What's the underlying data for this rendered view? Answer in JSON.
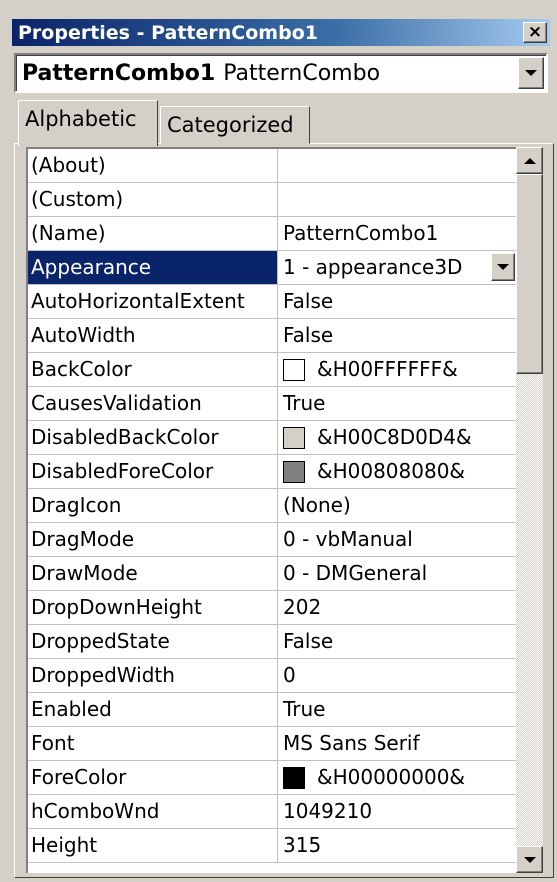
{
  "window": {
    "title": "Properties - PatternCombo1",
    "close_glyph": "×"
  },
  "object_selector": {
    "name": "PatternCombo1",
    "class": "PatternCombo"
  },
  "tabs": [
    {
      "label": "Alphabetic",
      "active": true
    },
    {
      "label": "Categorized",
      "active": false
    }
  ],
  "properties": [
    {
      "name": "(About)",
      "value": ""
    },
    {
      "name": "(Custom)",
      "value": ""
    },
    {
      "name": "(Name)",
      "value": "PatternCombo1"
    },
    {
      "name": "Appearance",
      "value": "1 - appearance3D",
      "selected": true
    },
    {
      "name": "AutoHorizontalExtent",
      "value": "False"
    },
    {
      "name": "AutoWidth",
      "value": "False"
    },
    {
      "name": "BackColor",
      "value": "&H00FFFFFF&",
      "swatch": "#ffffff"
    },
    {
      "name": "CausesValidation",
      "value": "True"
    },
    {
      "name": "DisabledBackColor",
      "value": "&H00C8D0D4&",
      "swatch": "#d4d0c8"
    },
    {
      "name": "DisabledForeColor",
      "value": "&H00808080&",
      "swatch": "#808080"
    },
    {
      "name": "DragIcon",
      "value": "(None)"
    },
    {
      "name": "DragMode",
      "value": "0 - vbManual"
    },
    {
      "name": "DrawMode",
      "value": "0 - DMGeneral"
    },
    {
      "name": "DropDownHeight",
      "value": "202"
    },
    {
      "name": "DroppedState",
      "value": "False"
    },
    {
      "name": "DroppedWidth",
      "value": "0"
    },
    {
      "name": "Enabled",
      "value": "True"
    },
    {
      "name": "Font",
      "value": "MS Sans Serif"
    },
    {
      "name": "ForeColor",
      "value": "&H00000000&",
      "swatch": "#000000"
    },
    {
      "name": "hComboWnd",
      "value": "1049210"
    },
    {
      "name": "Height",
      "value": "315"
    }
  ],
  "colors": {
    "titlebar": "#0a246a",
    "selection": "#0a246a",
    "face": "#d4d0c8"
  }
}
